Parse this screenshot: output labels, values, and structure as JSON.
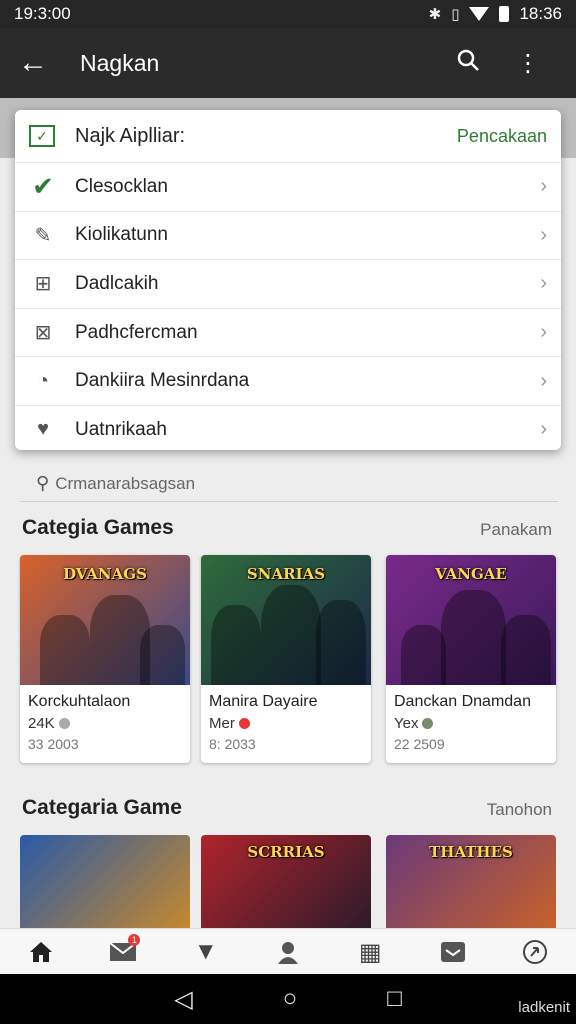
{
  "status": {
    "time": "19:3:00",
    "clock": "18:36"
  },
  "appbar": {
    "back_icon": "arrow-left-icon",
    "title": "Nagkan",
    "search_icon": "search-icon",
    "more_icon": "more-vert-icon"
  },
  "menu": {
    "header": {
      "title": "Najk Aiplliar:",
      "action": "Pencakaan",
      "icon": "mail-check-icon"
    },
    "items": [
      {
        "label": "Clesocklan",
        "icon": "checkmark-icon"
      },
      {
        "label": "Kiolikatunn",
        "icon": "edit-icon"
      },
      {
        "label": "Dadlcakih",
        "icon": "grid-icon"
      },
      {
        "label": "Padhcfercman",
        "icon": "calendar-icon"
      },
      {
        "label": "Dankiira Mesinrdana",
        "icon": "pie-icon"
      },
      {
        "label": "Uatnrikaah",
        "icon": "heart-icon"
      }
    ]
  },
  "search": {
    "placeholder": "Crmanarabsagsan"
  },
  "section1": {
    "title": "Categia Games",
    "link": "Panakam",
    "cards": [
      {
        "title_art": "DVANAGS",
        "name": "Korckuhtalaon",
        "meta": "24K",
        "date": "33 2003",
        "colors": [
          "#d9622b",
          "#3a4a8a"
        ]
      },
      {
        "title_art": "SNARIAS",
        "name": "Manira Dayaire",
        "meta": "Mer",
        "date": "8: 2033",
        "colors": [
          "#2f6b3a",
          "#1a2a4a"
        ]
      },
      {
        "title_art": "VANGAE",
        "name": "Danckan Dnamdan",
        "meta": "Yex",
        "date": "22 2509",
        "colors": [
          "#7a2a8a",
          "#3a1a5a"
        ]
      }
    ]
  },
  "section2": {
    "title": "Categaria Game",
    "link": "Tanohon",
    "cards": [
      {
        "title_art": "",
        "colors": [
          "#2a5aa8",
          "#c9892a"
        ]
      },
      {
        "title_art": "SCRRIAS",
        "colors": [
          "#b0242a",
          "#2a1a2a"
        ]
      },
      {
        "title_art": "THATHES",
        "colors": [
          "#6a3a7a",
          "#c9622a"
        ]
      }
    ]
  },
  "bottomnav": {
    "items": [
      "home-icon",
      "mail-icon",
      "thumbs-down-icon",
      "profile-icon",
      "list-icon",
      "inbox-icon",
      "refresh-icon"
    ],
    "badge": "1"
  },
  "sysnav": {
    "watermark": "ladkenit"
  }
}
